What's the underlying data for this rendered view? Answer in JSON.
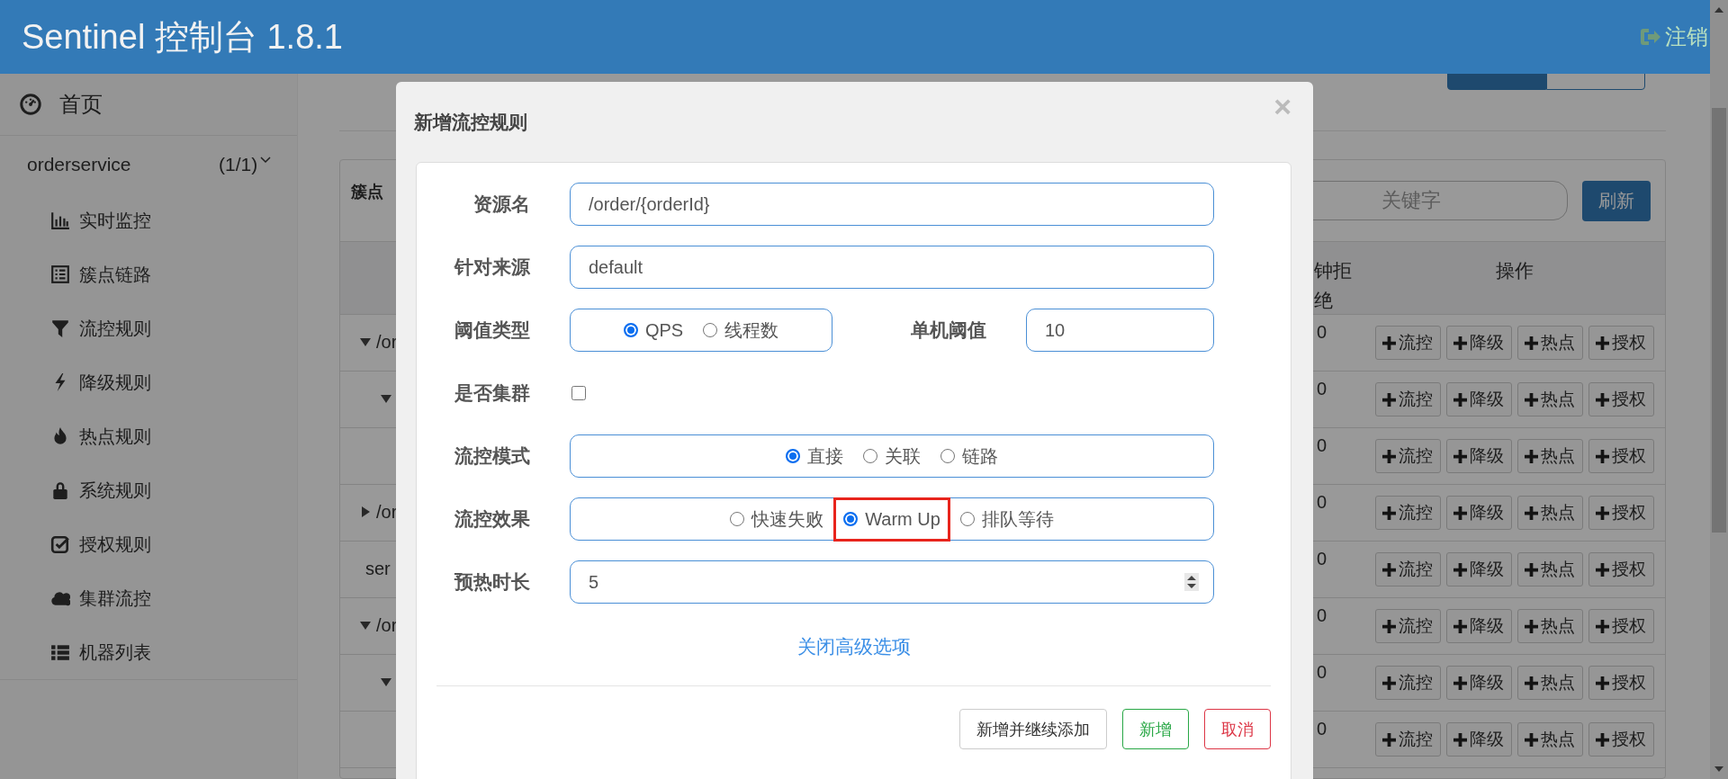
{
  "header": {
    "title": "Sentinel 控制台 1.8.1",
    "logout": "注销"
  },
  "sidebar": {
    "home": {
      "label": "首页"
    },
    "app": {
      "name": "orderservice",
      "count": "(1/1)",
      "expanded": true
    },
    "items": [
      {
        "label": "实时监控",
        "kind": "bar-chart"
      },
      {
        "label": "簇点链路",
        "kind": "list"
      },
      {
        "label": "流控规则",
        "kind": "filter"
      },
      {
        "label": "降级规则",
        "kind": "bolt"
      },
      {
        "label": "热点规则",
        "kind": "fire"
      },
      {
        "label": "系统规则",
        "kind": "lock"
      },
      {
        "label": "授权规则",
        "kind": "check"
      },
      {
        "label": "集群流控",
        "kind": "cloud"
      },
      {
        "label": "机器列表",
        "kind": "th-list"
      }
    ]
  },
  "page": {
    "view_buttons": [
      {
        "selected": true
      },
      {
        "selected": false
      }
    ]
  },
  "panel": {
    "title": "簇点",
    "search": {
      "placeholder": "关键字"
    },
    "refresh": "刷新",
    "columns": [
      {
        "label": "钟拒绝"
      },
      {
        "label": "操作"
      }
    ],
    "rows": [
      {
        "resource": "/or",
        "expanded": true,
        "value": "0",
        "actions": [
          "流控",
          "降级",
          "热点",
          "授权"
        ],
        "children": [
          {
            "expanded": true,
            "value": "0",
            "actions": [
              "流控",
              "降级",
              "热点",
              "授权"
            ],
            "children": [
              {
                "value": "0",
                "actions": [
                  "流控",
                  "降级",
                  "热点",
                  "授权"
                ]
              }
            ]
          }
        ]
      },
      {
        "resource": "/or",
        "expanded": false,
        "value": "0",
        "actions": [
          "流控",
          "降级",
          "热点",
          "授权"
        ]
      },
      {
        "resource": "ser",
        "value": "0",
        "actions": [
          "流控",
          "降级",
          "热点",
          "授权"
        ]
      },
      {
        "resource": "/or",
        "expanded": true,
        "value": "0",
        "actions": [
          "流控",
          "降级",
          "热点",
          "授权"
        ],
        "children": [
          {
            "expanded": true,
            "value": "0",
            "actions": [
              "流控",
              "降级",
              "热点",
              "授权"
            ],
            "children": [
              {
                "value": "0",
                "actions": [
                  "流控",
                  "降级",
                  "热点",
                  "授权"
                ]
              }
            ]
          }
        ]
      }
    ]
  },
  "dialog": {
    "title": "新增流控规则",
    "close": "×",
    "fields": [
      {
        "kind": "text",
        "label": "资源名",
        "value": "/order/{orderId}"
      },
      {
        "kind": "text",
        "label": "针对来源",
        "value": "default"
      },
      {
        "kind": "radio",
        "label": "阈值类型",
        "options": [
          {
            "label": "QPS",
            "selected": true,
            "highlighted": false
          },
          {
            "label": "线程数",
            "selected": false,
            "highlighted": false
          }
        ],
        "side_label": "单机阈值",
        "side_value": "10"
      },
      {
        "kind": "checkbox",
        "label": "是否集群",
        "checked": false
      },
      {
        "kind": "radio",
        "label": "流控模式",
        "options": [
          {
            "label": "直接",
            "selected": true,
            "highlighted": false
          },
          {
            "label": "关联",
            "selected": false,
            "highlighted": false
          },
          {
            "label": "链路",
            "selected": false,
            "highlighted": false
          }
        ]
      },
      {
        "kind": "radio",
        "label": "流控效果",
        "options": [
          {
            "label": "快速失败",
            "selected": false,
            "highlighted": false
          },
          {
            "label": "Warm Up",
            "selected": true,
            "highlighted": true
          },
          {
            "label": "排队等待",
            "selected": false,
            "highlighted": false
          }
        ]
      },
      {
        "kind": "number",
        "label": "预热时长",
        "value": "5"
      }
    ],
    "toggle_link": "关闭高级选项",
    "buttons": [
      {
        "label": "新增并继续添加",
        "kind": "default"
      },
      {
        "label": "新增",
        "kind": "success"
      },
      {
        "label": "取消",
        "kind": "danger"
      }
    ]
  }
}
